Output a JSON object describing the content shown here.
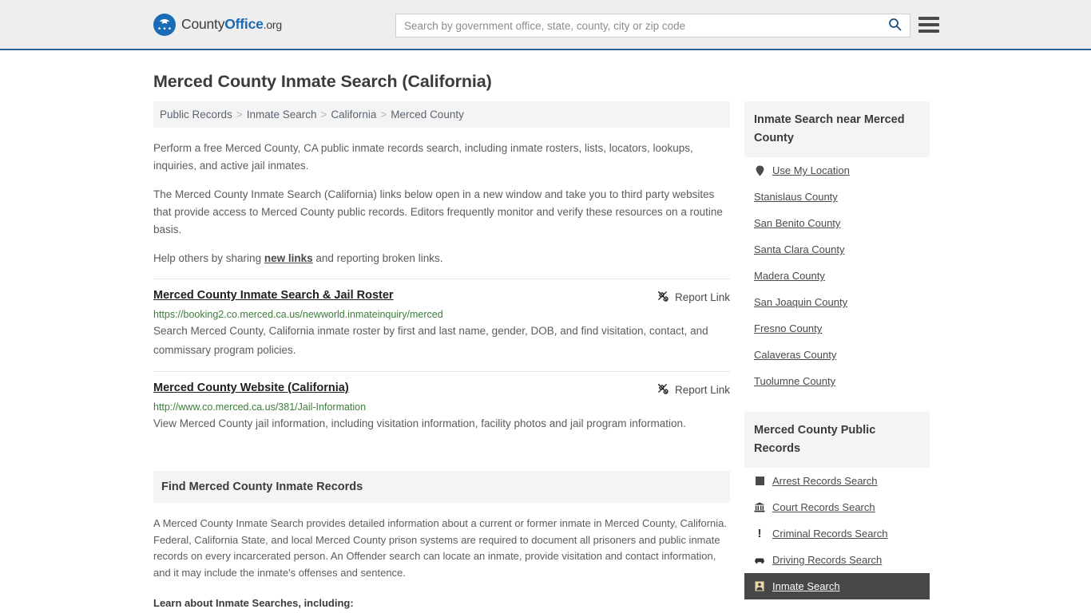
{
  "header": {
    "logo": {
      "part1": "County",
      "part2": "Office",
      "part3": ".org"
    },
    "search": {
      "placeholder": "Search by government office, state, county, city or zip code",
      "value": ""
    },
    "accent_color": "#2a6496",
    "background_color": "#eeeeee"
  },
  "page": {
    "title": "Merced County Inmate Search (California)"
  },
  "breadcrumb": {
    "separator": ">",
    "items": [
      {
        "label": "Public Records"
      },
      {
        "label": "Inmate Search"
      },
      {
        "label": "California"
      },
      {
        "label": "Merced County"
      }
    ]
  },
  "intro": {
    "p1": "Perform a free Merced County, CA public inmate records search, including inmate rosters, lists, locators, lookups, inquiries, and active jail inmates.",
    "p2": "The Merced County Inmate Search (California) links below open in a new window and take you to third party websites that provide access to Merced County public records. Editors frequently monitor and verify these resources on a routine basis.",
    "p3_before": "Help others by sharing ",
    "p3_link": "new links",
    "p3_after": " and reporting broken links."
  },
  "results": {
    "report_label": "Report Link",
    "items": [
      {
        "title": "Merced County Inmate Search & Jail Roster",
        "url": "https://booking2.co.merced.ca.us/newworld.inmateinquiry/merced",
        "description": "Search Merced County, California inmate roster by first and last name, gender, DOB, and find visitation, contact, and commissary program policies.",
        "report_label": "Report Link"
      },
      {
        "title": "Merced County Website (California)",
        "url": "http://www.co.merced.ca.us/381/Jail-Information",
        "description": "View Merced County jail information, including visitation information, facility photos and jail program information.",
        "report_label": "Report Link"
      }
    ]
  },
  "find_section": {
    "heading": "Find Merced County Inmate Records",
    "paragraph": "A Merced County Inmate Search provides detailed information about a current or former inmate in Merced County, California. Federal, California State, and local Merced County prison systems are required to document all prisoners and public inmate records on every incarcerated person. An Offender search can locate an inmate, provide visitation and contact information, and it may include the inmate's offenses and sentence.",
    "lead_in": "Learn about Inmate Searches, including:"
  },
  "sidebar": {
    "near_panel": {
      "heading": "Inmate Search near Merced County",
      "items": [
        {
          "label": "Use My Location",
          "icon": "map-pin-icon"
        },
        {
          "label": "Stanislaus County",
          "icon": ""
        },
        {
          "label": "San Benito County",
          "icon": ""
        },
        {
          "label": "Santa Clara County",
          "icon": ""
        },
        {
          "label": "Madera County",
          "icon": ""
        },
        {
          "label": "San Joaquin County",
          "icon": ""
        },
        {
          "label": "Fresno County",
          "icon": ""
        },
        {
          "label": "Calaveras County",
          "icon": ""
        },
        {
          "label": "Tuolumne County",
          "icon": ""
        }
      ]
    },
    "records_panel": {
      "heading": "Merced County Public Records",
      "items": [
        {
          "label": "Arrest Records Search",
          "icon": "fingerprint-icon",
          "active": false
        },
        {
          "label": "Court Records Search",
          "icon": "courthouse-icon",
          "active": false
        },
        {
          "label": "Criminal Records Search",
          "icon": "exclamation-icon",
          "active": false
        },
        {
          "label": "Driving Records Search",
          "icon": "car-icon",
          "active": false
        },
        {
          "label": "Inmate Search",
          "icon": "inmate-icon",
          "active": true
        }
      ]
    },
    "active_background": "#474747"
  }
}
